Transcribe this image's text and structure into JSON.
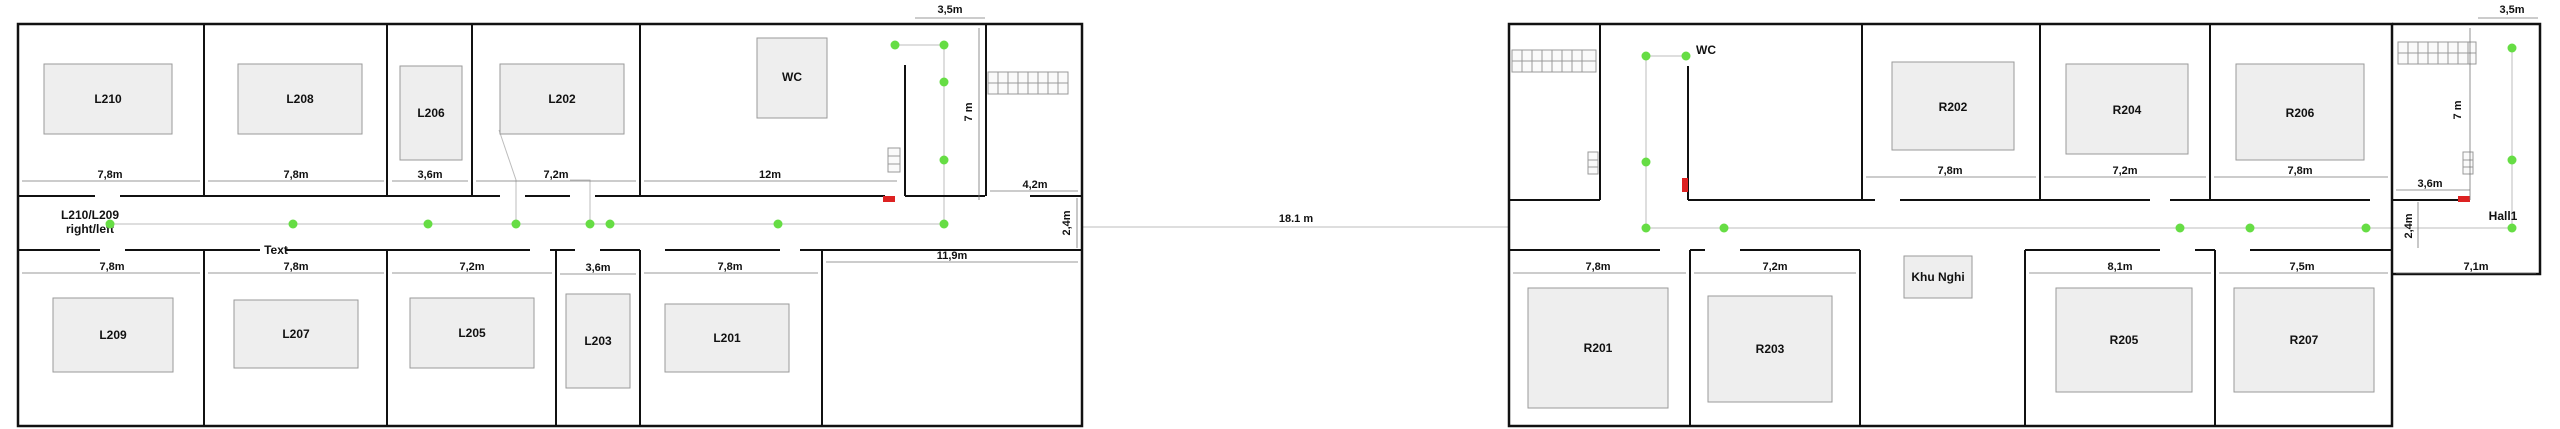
{
  "colors": {
    "wall": "#111111",
    "room_box_fill": "#eeeeee",
    "room_box_stroke": "#9a9a9a",
    "node": "#66dd44",
    "path_line": "#bdbdbd",
    "door": "#dd2222"
  },
  "left_building": {
    "rooms": {
      "l210": "L210",
      "l208": "L208",
      "l206": "L206",
      "l202": "L202",
      "wc": "WC",
      "l209": "L209",
      "l207": "L207",
      "l205": "L205",
      "l203": "L203",
      "l201": "L201"
    },
    "hall_label_line1": "L210/L209",
    "hall_label_line2": "right/left",
    "text_label": "Text",
    "dims": {
      "top_l210": "7,8m",
      "top_l208": "7,8m",
      "top_l206": "3,6m",
      "top_l202": "7,2m",
      "top_wc": "12m",
      "top_right": "4,2m",
      "bottom_l209": "7,8m",
      "bottom_l207": "7,8m",
      "bottom_l205": "7,2m",
      "bottom_l203": "3,6m",
      "bottom_l201": "7,8m",
      "bottom_right": "11,9m",
      "corridor": "2,4m",
      "stair_width": "3,5m",
      "stair_height": "7 m"
    }
  },
  "connector_label": "18.1 m",
  "right_building": {
    "rooms": {
      "wc": "WC",
      "r202": "R202",
      "r204": "R204",
      "r206": "R206",
      "khu_nghi": "Khu Nghi",
      "r201": "R201",
      "r203": "R203",
      "r205": "R205",
      "r207": "R207"
    },
    "hall_label": "Hall1",
    "dims": {
      "top_r202": "7,8m",
      "top_r204": "7,2m",
      "top_r206": "7,8m",
      "top_right": "3,6m",
      "bottom_r201": "7,8m",
      "bottom_r203": "7,2m",
      "bottom_r205": "8,1m",
      "bottom_r207": "7,5m",
      "bottom_right": "7,1m",
      "corridor": "2,4m",
      "stair_width": "3,5m",
      "stair_height": "7 m"
    }
  }
}
